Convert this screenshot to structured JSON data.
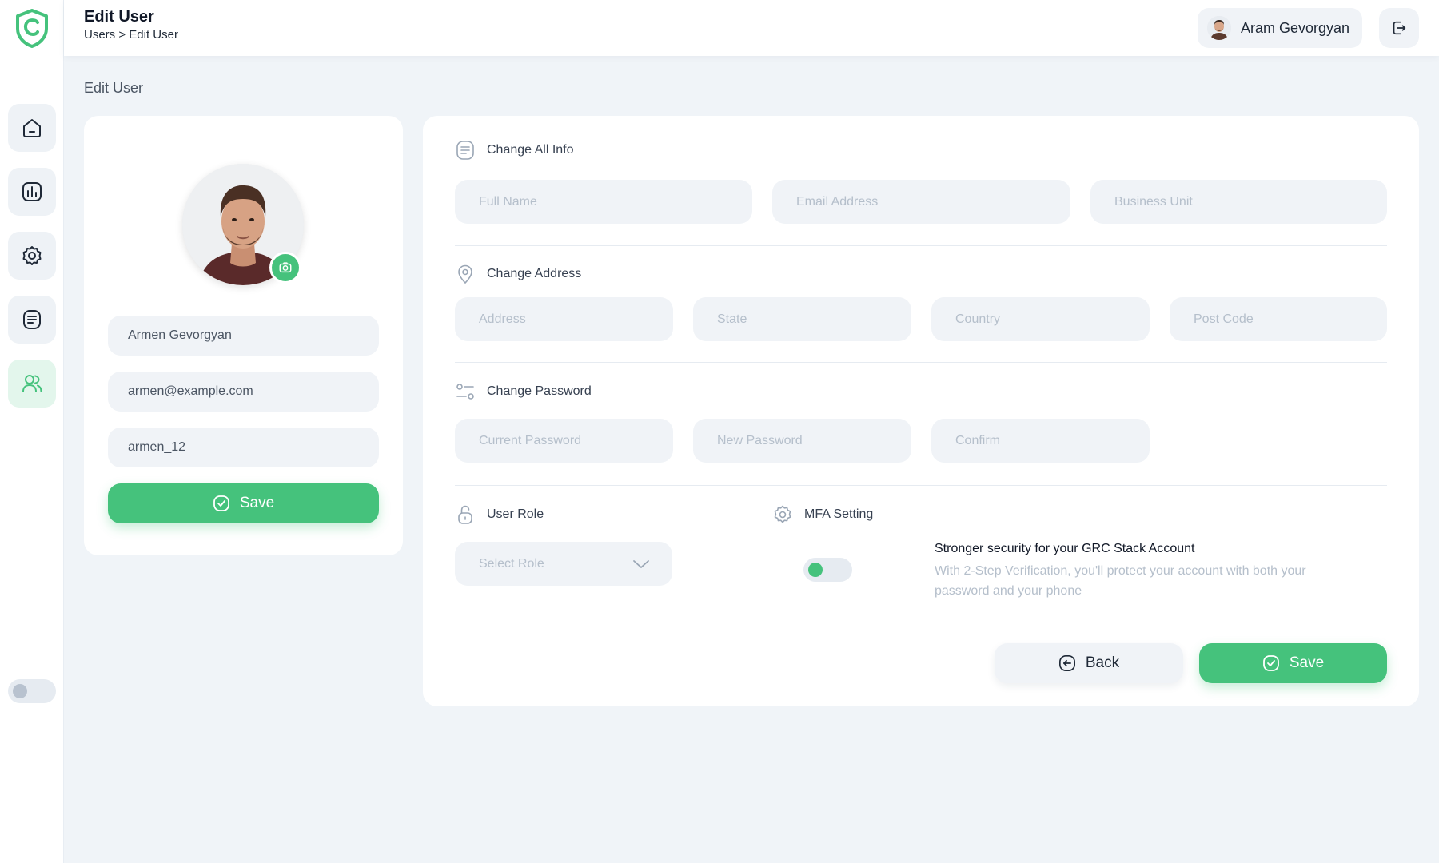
{
  "colors": {
    "accent": "#45c27c",
    "background": "#f0f4f8",
    "field": "#f0f3f7"
  },
  "sidebar": {
    "items": [
      {
        "name": "home",
        "icon": "home-icon"
      },
      {
        "name": "reports",
        "icon": "bar-chart-icon"
      },
      {
        "name": "settings",
        "icon": "gear-icon"
      },
      {
        "name": "documents",
        "icon": "document-icon"
      },
      {
        "name": "users",
        "icon": "users-icon",
        "active": true
      }
    ]
  },
  "header": {
    "title": "Edit User",
    "breadcrumb": "Users > Edit User",
    "user_name": "Aram Gevorgyan"
  },
  "page": {
    "label": "Edit User"
  },
  "profile": {
    "full_name": "Armen Gevorgyan",
    "email": "armen@example.com",
    "username": "armen_12",
    "save_label": "Save"
  },
  "form": {
    "info": {
      "title": "Change All Info",
      "full_name_placeholder": "Full Name",
      "email_placeholder": "Email Address",
      "business_unit_placeholder": "Business Unit"
    },
    "address": {
      "title": "Change Address",
      "address_placeholder": "Address",
      "state_placeholder": "State",
      "country_placeholder": "Country",
      "post_code_placeholder": "Post Code"
    },
    "password": {
      "title": "Change Password",
      "current_placeholder": "Current Password",
      "new_placeholder": "New Password",
      "confirm_placeholder": "Confirm"
    },
    "role": {
      "title": "User Role",
      "select_placeholder": "Select Role"
    },
    "mfa": {
      "title": "MFA Setting",
      "heading": "Stronger security for your GRC Stack Account",
      "description": "With 2-Step Verification, you'll protect your account with both your password and your phone",
      "enabled": true
    },
    "back_label": "Back",
    "save_label": "Save"
  }
}
